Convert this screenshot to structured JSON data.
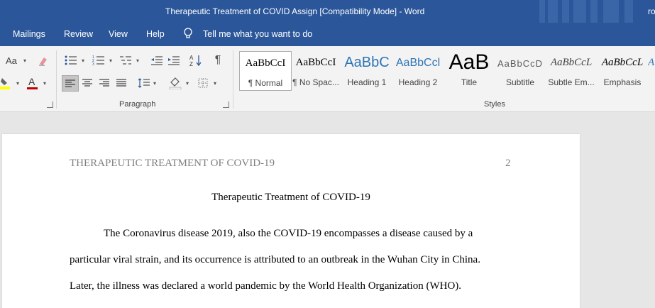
{
  "titlebar": {
    "title": "Therapeutic Treatment of COVID Assign [Compatibility Mode]  -  Word",
    "user": "ro"
  },
  "menu": {
    "mailings": "Mailings",
    "review": "Review",
    "view": "View",
    "help": "Help",
    "tellme": "Tell me what you want to do"
  },
  "ribbon": {
    "font_size_label": "Aa",
    "paragraph_group": "Paragraph",
    "styles_group": "Styles",
    "styles": [
      {
        "sample": "AaBbCcI",
        "label": "¶ Normal"
      },
      {
        "sample": "AaBbCcI",
        "label": "¶ No Spac..."
      },
      {
        "sample": "AaBbC",
        "label": "Heading 1"
      },
      {
        "sample": "AaBbCcl",
        "label": "Heading 2"
      },
      {
        "sample": "AaB",
        "label": "Title"
      },
      {
        "sample": "AaBbCcD",
        "label": "Subtitle"
      },
      {
        "sample": "AaBbCcL",
        "label": "Subtle Em..."
      },
      {
        "sample": "AaBbCcL",
        "label": "Emphasis"
      },
      {
        "sample": "A",
        "label": ""
      }
    ],
    "colors": {
      "highlight": "#ffff00",
      "font_color": "#c00000",
      "brand": "#2b579a"
    }
  },
  "document": {
    "header": "THERAPEUTIC TREATMENT OF COVID-19",
    "page_number": "2",
    "title": "Therapeutic Treatment of COVID-19",
    "lines": [
      "The Coronavirus disease 2019, also the COVID-19 encompasses a disease caused by a",
      "particular viral strain, and its occurrence is attributed to an outbreak in the Wuhan City in China.",
      "Later, the illness was declared a world pandemic by the World Health Organization (WHO)."
    ]
  }
}
